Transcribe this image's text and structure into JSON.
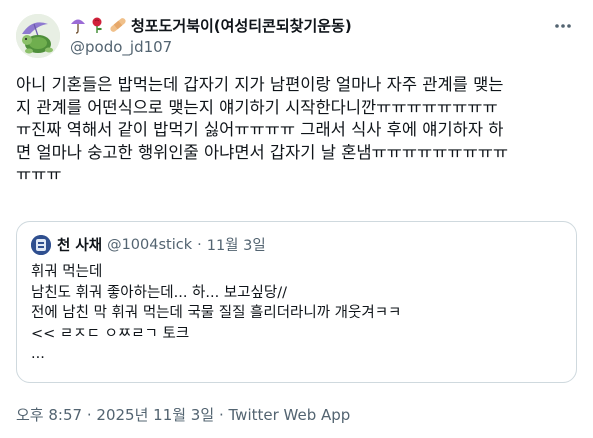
{
  "author": {
    "display_name": "청포도거북이(여성티콘되찾기운동)",
    "handle": "@podo_jd107",
    "emoji_icons": [
      "umbrella-icon",
      "rose-icon",
      "bandage-icon"
    ]
  },
  "tweet": {
    "lines": [
      "아니 기혼들은 밥먹는데 갑자기 지가 남편이랑 얼마나 자주 관계를 맺는",
      "지 관계를 어떤식으로 맺는지 얘기하기 시작한다니깐ㅠㅠㅠㅠㅠㅠㅠㅠ",
      "ㅠ진짜 역해서 같이 밥먹기 싫어ㅠㅠㅠㅠ 그래서 식사 후에 얘기하자 하",
      "면 얼마나 숭고한 행위인줄 아냐면서 갑자기 날 혼냄ㅠㅠㅠㅠㅠㅠㅠㅠㅠ",
      "ㅠㅠㅠ"
    ]
  },
  "quote": {
    "name": "천 사채",
    "handle": "@1004stick",
    "separator": "·",
    "date": "11월 3일",
    "lines": [
      "휘궈 먹는데",
      "남친도 휘궈 좋아하는데... 하... 보고싶당//",
      "전에 남친 막 휘궈 먹는데 국물 질질 흘리더라니까 개웃겨ㅋㅋ",
      "<< ㄹㅈㄷ ㅇㅉㄹㄱ 토크",
      "..."
    ]
  },
  "meta": {
    "time": "오후 8:57",
    "separator1": "·",
    "date": "2025년 11월 3일",
    "separator2": "·",
    "source": "Twitter Web App"
  },
  "colors": {
    "text": "#0f1419",
    "secondary": "#536471",
    "border": "#cfd9de"
  }
}
